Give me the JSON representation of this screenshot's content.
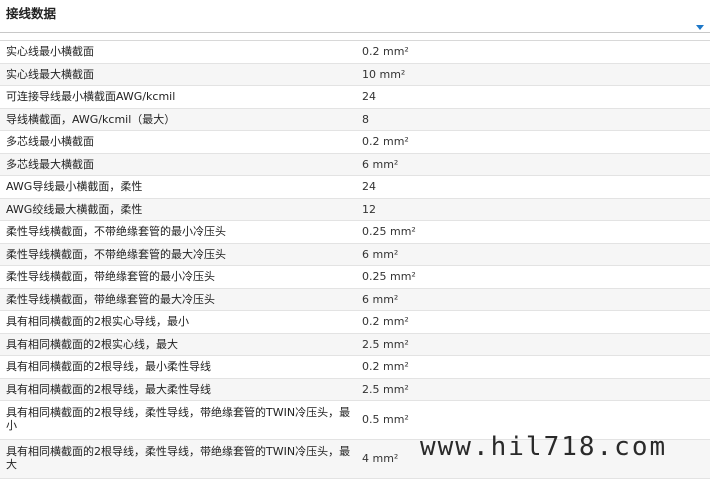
{
  "header": {
    "title": "接线数据"
  },
  "table": {
    "rows": [
      {
        "label": "实心线最小横截面",
        "value": "0.2 mm²"
      },
      {
        "label": "实心线最大横截面",
        "value": "10 mm²"
      },
      {
        "label": "可连接导线最小横截面AWG/kcmil",
        "value": "24"
      },
      {
        "label": "导线横截面，AWG/kcmil（最大）",
        "value": "8"
      },
      {
        "label": "多芯线最小横截面",
        "value": "0.2 mm²"
      },
      {
        "label": "多芯线最大横截面",
        "value": "6 mm²"
      },
      {
        "label": "AWG导线最小横截面，柔性",
        "value": "24"
      },
      {
        "label": "AWG绞线最大横截面，柔性",
        "value": "12"
      },
      {
        "label": "柔性导线横截面，不带绝缘套管的最小冷压头",
        "value": "0.25 mm²"
      },
      {
        "label": "柔性导线横截面，不带绝缘套管的最大冷压头",
        "value": "6 mm²"
      },
      {
        "label": "柔性导线横截面，带绝缘套管的最小冷压头",
        "value": "0.25 mm²"
      },
      {
        "label": "柔性导线横截面，带绝缘套管的最大冷压头",
        "value": "6 mm²"
      },
      {
        "label": "具有相同横截面的2根实心导线，最小",
        "value": "0.2 mm²"
      },
      {
        "label": "具有相同横截面的2根实心线，最大",
        "value": "2.5 mm²"
      },
      {
        "label": "具有相同横截面的2根导线，最小柔性导线",
        "value": "0.2 mm²"
      },
      {
        "label": "具有相同横截面的2根导线，最大柔性导线",
        "value": "2.5 mm²"
      },
      {
        "label": "具有相同横截面的2根导线，柔性导线，带绝缘套管的TWIN冷压头，最小",
        "value": "0.5 mm²"
      },
      {
        "label": "具有相同横截面的2根导线，柔性导线，带绝缘套管的TWIN冷压头，最大",
        "value": "4 mm²"
      }
    ]
  },
  "watermark": {
    "text": "www.hil718.com"
  }
}
